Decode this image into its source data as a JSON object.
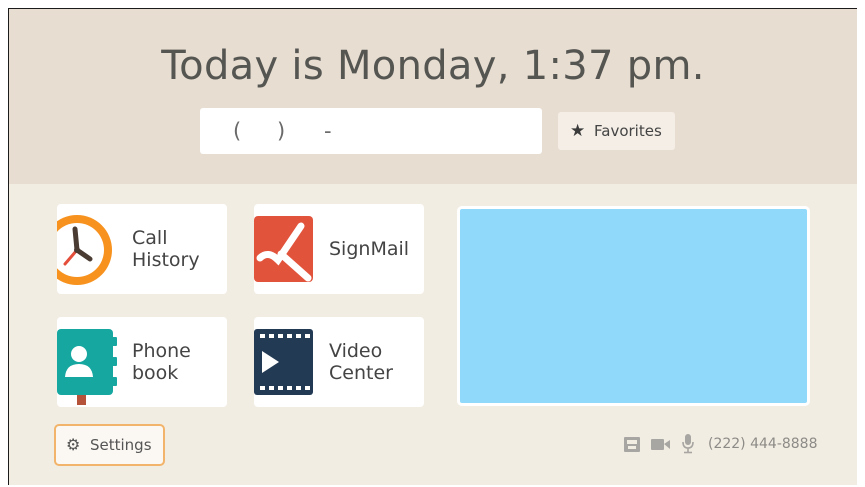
{
  "header": {
    "title": "Today is Monday, 1:37 pm."
  },
  "dialer": {
    "open_paren": "(",
    "close_paren": ")",
    "dash": "-"
  },
  "favorites": {
    "label": "Favorites",
    "icon": "star-icon"
  },
  "tiles": [
    {
      "label": "Call\nHistory",
      "icon": "clock-icon",
      "icon_color": "#f7921e"
    },
    {
      "label": "SignMail",
      "icon": "signmail-icon",
      "icon_color": "#e2533c"
    },
    {
      "label": "Phone\nbook",
      "icon": "phonebook-icon",
      "icon_color": "#15a7a0"
    },
    {
      "label": "Video\nCenter",
      "icon": "film-icon",
      "icon_color": "#233a54"
    }
  ],
  "video_preview": {
    "color": "#91d9fb"
  },
  "settings": {
    "label": "Settings",
    "icon": "gear-icon",
    "accent": "#f2b46a"
  },
  "status_bar": {
    "phone_number": "(222) 444-8888",
    "icons": [
      "network-icon",
      "camera-icon",
      "microphone-icon"
    ]
  },
  "colors": {
    "header_bg": "#e7ddd1",
    "body_bg": "#f2ede3",
    "tile_bg": "#ffffff"
  }
}
